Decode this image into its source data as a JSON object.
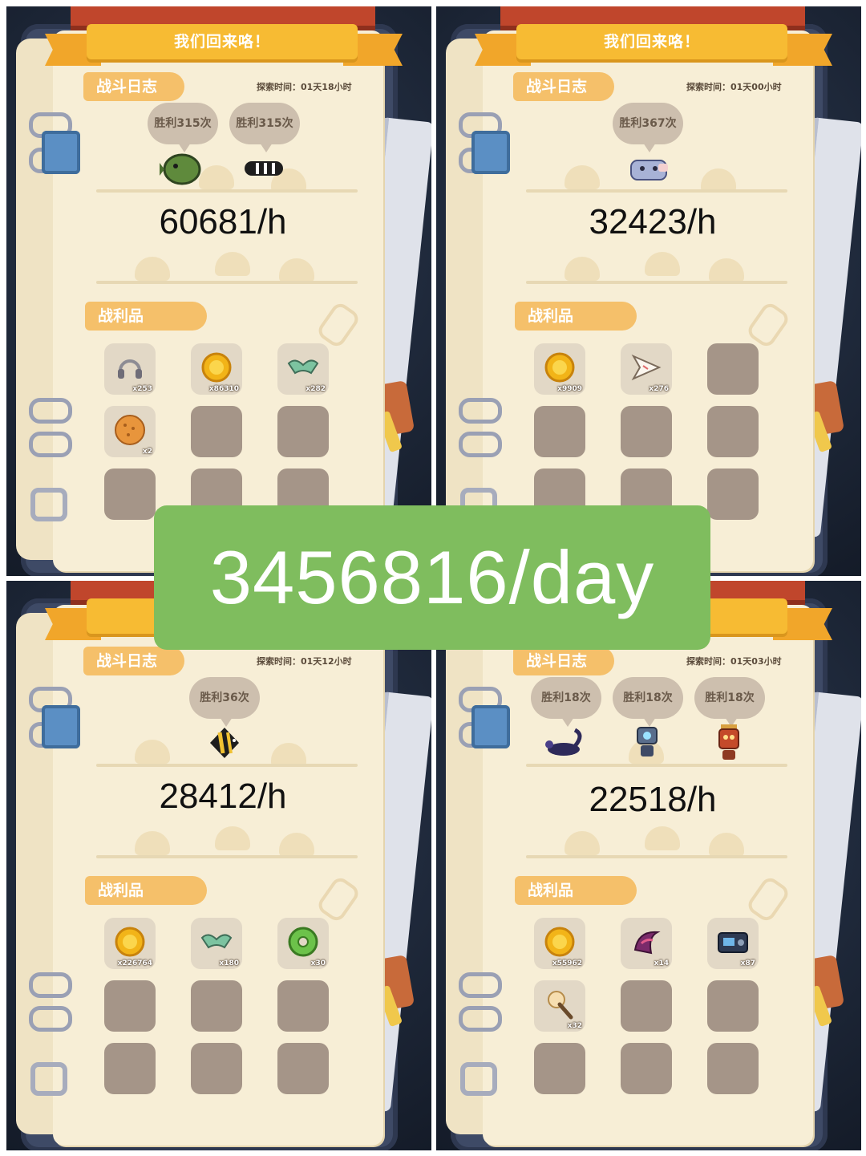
{
  "colors": {
    "accent_green": "#7fbd5e",
    "ribbon": "#f7bb33",
    "label": "#f5c06a",
    "page": "#f7eed6",
    "empty_slot": "#a59588"
  },
  "banner_title": "我们回来咯！",
  "log_label": "战斗日志",
  "loot_label": "战利品",
  "summary": "3456816/day",
  "panels": [
    {
      "explore_time": "探索时间：01天18小时",
      "wins": [
        "胜利315次",
        "胜利315次"
      ],
      "monsters": [
        "pufferfish-monster-icon",
        "striped-eel-monster-icon"
      ],
      "rate": "60681/h",
      "loot": [
        {
          "icon": "headphones-icon",
          "qty": "x253"
        },
        {
          "icon": "gold-coin-icon",
          "qty": "x86310"
        },
        {
          "icon": "green-mask-icon",
          "qty": "x282"
        },
        {
          "icon": "cookie-icon",
          "qty": "x2"
        }
      ]
    },
    {
      "explore_time": "探索时间：01天00小时",
      "wins": [
        "胜利367次"
      ],
      "monsters": [
        "crab-sofa-monster-icon"
      ],
      "rate": "32423/h",
      "loot": [
        {
          "icon": "gold-coin-icon",
          "qty": "x9909"
        },
        {
          "icon": "paper-plane-icon",
          "qty": "x276"
        }
      ]
    },
    {
      "explore_time": "探索时间：01天12小时",
      "wins": [
        "胜利36次"
      ],
      "monsters": [
        "angelfish-monster-icon"
      ],
      "rate": "28412/h",
      "loot": [
        {
          "icon": "gold-coin-icon",
          "qty": "x226764"
        },
        {
          "icon": "green-mask-icon",
          "qty": "x180"
        },
        {
          "icon": "green-donut-icon",
          "qty": "x30"
        }
      ]
    },
    {
      "explore_time": "探索时间：01天03小时",
      "wins": [
        "胜利18次",
        "胜利18次",
        "胜利18次"
      ],
      "monsters": [
        "scorpion-monster-icon",
        "robot-monster-icon",
        "lantern-robot-monster-icon"
      ],
      "rate": "22518/h",
      "loot": [
        {
          "icon": "gold-coin-icon",
          "qty": "x55962"
        },
        {
          "icon": "purple-claw-icon",
          "qty": "x14"
        },
        {
          "icon": "camera-box-icon",
          "qty": "x87"
        },
        {
          "icon": "ice-cream-stick-icon",
          "qty": "x32"
        }
      ]
    }
  ]
}
